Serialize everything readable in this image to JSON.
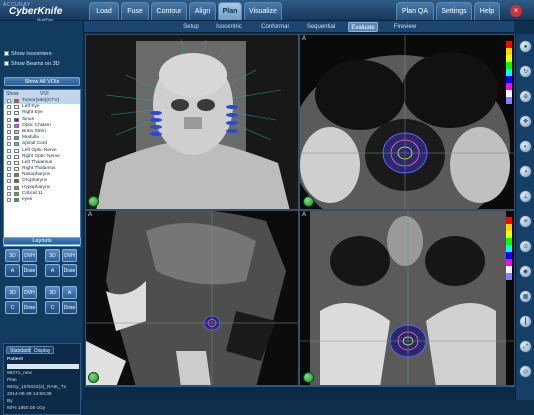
{
  "app": {
    "accent": "ACCURAY",
    "brand": "CyberKnife",
    "sub": "MultiPlan"
  },
  "tabs": [
    "Load",
    "Fuse",
    "Contour",
    "Align",
    "Plan",
    "Visualize",
    "Plan QA",
    "Settings",
    "Help"
  ],
  "active_tab": "Plan",
  "subtabs": [
    "Setup",
    "Isocentric",
    "Conformal",
    "Sequential",
    "Evaluate",
    "Fireview"
  ],
  "active_subtab": "Evaluate",
  "left": {
    "show_isocenters": "Show Isocenters",
    "show_beams": "Show Beams on 3D",
    "show_all_vois": "Show All VOIs",
    "voi_col_show": "Show",
    "voi_col_voi": "VOI",
    "vois": [
      {
        "name": "Tumor(site)(CTV)",
        "color": "#ff2a2a"
      },
      {
        "name": "Left Eye",
        "color": "#ffffff"
      },
      {
        "name": "Right Eye",
        "color": "#ffffff"
      },
      {
        "name": "Sinus",
        "color": "#5a2a8a"
      },
      {
        "name": "Optic Chiasm",
        "color": "#ff40ff"
      },
      {
        "name": "Brain Stem",
        "color": "#c0c0c0"
      },
      {
        "name": "Medulla",
        "color": "#2aa0e0"
      },
      {
        "name": "Spinal Cord",
        "color": "#30c8f0"
      },
      {
        "name": "Left Optic Nerve",
        "color": "#ffffff"
      },
      {
        "name": "Right Optic Nerve",
        "color": "#ffffff"
      },
      {
        "name": "Left Thalamus",
        "color": "#ffffff"
      },
      {
        "name": "Right Thalamus",
        "color": "#ffffff"
      },
      {
        "name": "Nasopharynx",
        "color": "#6a8a2a"
      },
      {
        "name": "Oropharynx",
        "color": "#2a7a4a"
      },
      {
        "name": "Hypopharynx",
        "color": "#b08a2a"
      },
      {
        "name": "Critical 11",
        "color": "#2ac040"
      },
      {
        "name": "eyes",
        "color": "#4a9a3a"
      }
    ],
    "layouts_title": "Layouts",
    "layout_buttons": [
      [
        "3D",
        "DVH",
        "3D",
        "DVH"
      ],
      [
        "A",
        "Dose",
        "A",
        "Dose"
      ],
      [
        "3D",
        "DVH",
        "3D",
        "A"
      ],
      [
        "C",
        "Dose",
        "C",
        "Dose"
      ]
    ],
    "patient_tabs": [
      "Standard",
      "Display"
    ],
    "patient_label": "Patient",
    "patient_lines": [
      "99271_new",
      "Plan",
      "90Gy_10/2022(2)_RAIK_Tx",
      "2014-06-28 14:56:36",
      "By",
      "80% 1850.00 cGy"
    ]
  },
  "views": {
    "labels": [
      "A",
      "A",
      "A",
      "A"
    ]
  },
  "colorbar": [
    "#ff0000",
    "#ffd400",
    "#ffff00",
    "#00ff00",
    "#00ffff",
    "#0000ff",
    "#ff00ff",
    "#ffffff",
    "#8080ff"
  ],
  "right_icons": [
    "eye-icon",
    "rotate-icon",
    "zoom-icon",
    "pan-icon",
    "window-icon",
    "contrast-icon",
    "measure-icon",
    "beam-icon",
    "iso-icon",
    "dose-icon",
    "grid-icon",
    "ruler-icon",
    "fit-icon",
    "camera-icon"
  ]
}
